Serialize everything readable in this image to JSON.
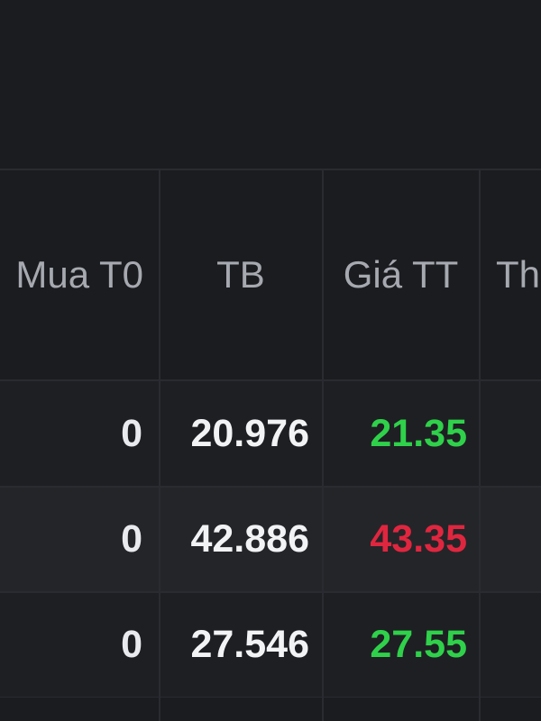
{
  "table": {
    "headers": {
      "mua_t0": "Mua T0",
      "tb": "TB",
      "gia_tt": "Giá TT",
      "th": "Th"
    },
    "rows": [
      {
        "mua_t0": "0",
        "tb": "20.976",
        "gia_tt": "21.35",
        "trend": "up"
      },
      {
        "mua_t0": "0",
        "tb": "42.886",
        "gia_tt": "43.35",
        "trend": "down"
      },
      {
        "mua_t0": "0",
        "tb": "27.546",
        "gia_tt": "27.55",
        "trend": "up"
      }
    ]
  },
  "colors": {
    "up": "#2fd14a",
    "down": "#e0263f",
    "background": "#1b1c20",
    "header_text": "#a7a9b0"
  }
}
